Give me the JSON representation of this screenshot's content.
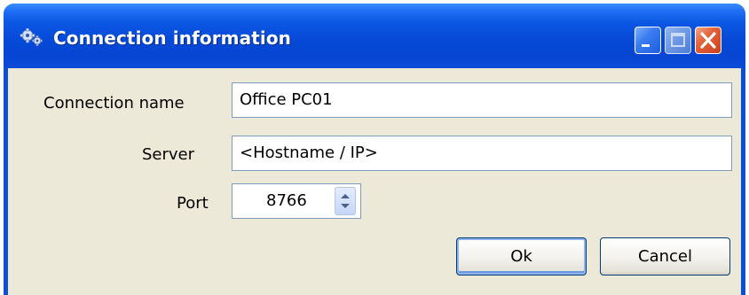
{
  "window": {
    "title": "Connection information",
    "title_icon": "gears-icon",
    "controls": {
      "minimize_icon": "minimize-icon",
      "maximize_icon": "maximize-icon",
      "close_icon": "close-icon"
    }
  },
  "form": {
    "connection_name_label": "Connection name",
    "connection_name_value": "Office PC01",
    "server_label": "Server",
    "server_value": "<Hostname / IP>",
    "port_label": "Port",
    "port_value": "8766"
  },
  "buttons": {
    "ok_label": "Ok",
    "cancel_label": "Cancel"
  },
  "colors": {
    "titlebar_blue": "#0b57e3",
    "client_background": "#ece9d8",
    "close_red": "#e5623a"
  }
}
